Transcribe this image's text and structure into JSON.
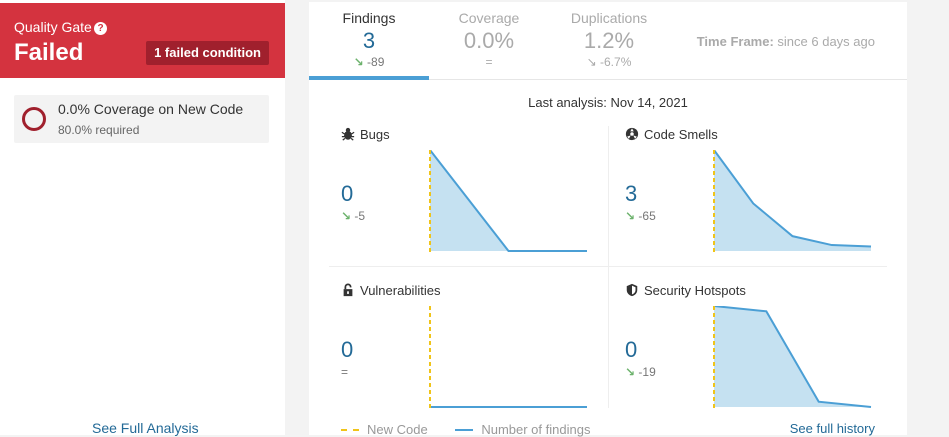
{
  "quality_gate": {
    "label": "Quality Gate",
    "help_icon": "?",
    "status": "Failed",
    "badge": "1 failed condition",
    "condition": {
      "title": "0.0% Coverage on New Code",
      "required": "80.0% required"
    },
    "see_full_analysis": "See Full Analysis"
  },
  "tabs": [
    {
      "label": "Findings",
      "value": "3",
      "delta": "-89",
      "delta_icon": "↘"
    },
    {
      "label": "Coverage",
      "value": "0.0%",
      "delta": "=",
      "delta_icon": ""
    },
    {
      "label": "Duplications",
      "value": "1.2%",
      "delta": "-6.7%",
      "delta_icon": "↘"
    }
  ],
  "time_frame": {
    "label": "Time Frame:",
    "value": "since 6 days ago"
  },
  "last_analysis": "Last analysis: Nov 14, 2021",
  "cells": [
    {
      "title": "Bugs",
      "icon": "bug-icon",
      "value": "0",
      "delta": "-5",
      "delta_icon": "↘"
    },
    {
      "title": "Code Smells",
      "icon": "smell-icon",
      "value": "3",
      "delta": "-65",
      "delta_icon": "↘"
    },
    {
      "title": "Vulnerabilities",
      "icon": "lock-icon",
      "value": "0",
      "delta": "=",
      "delta_icon": ""
    },
    {
      "title": "Security Hotspots",
      "icon": "shield-icon",
      "value": "0",
      "delta": "-19",
      "delta_icon": "↘"
    }
  ],
  "legend": {
    "new_code": "New Code",
    "number_of_findings": "Number of findings"
  },
  "see_full_history": "See full history",
  "colors": {
    "failed": "#d4333f",
    "link": "#236a97",
    "line": "#4b9fd5",
    "new_code": "#f0c419",
    "area": "#c5e1f1",
    "down": "#6cb26c"
  },
  "chart_data": [
    {
      "type": "area",
      "series": [
        {
          "values": [
            5,
            0,
            0
          ]
        }
      ]
    },
    {
      "type": "area",
      "series": [
        {
          "values": [
            68,
            32,
            10,
            4,
            3
          ]
        }
      ]
    },
    {
      "type": "area",
      "series": [
        {
          "values": [
            0,
            0,
            0
          ]
        }
      ]
    },
    {
      "type": "area",
      "series": [
        {
          "values": [
            19,
            18,
            1,
            0
          ]
        }
      ]
    }
  ]
}
